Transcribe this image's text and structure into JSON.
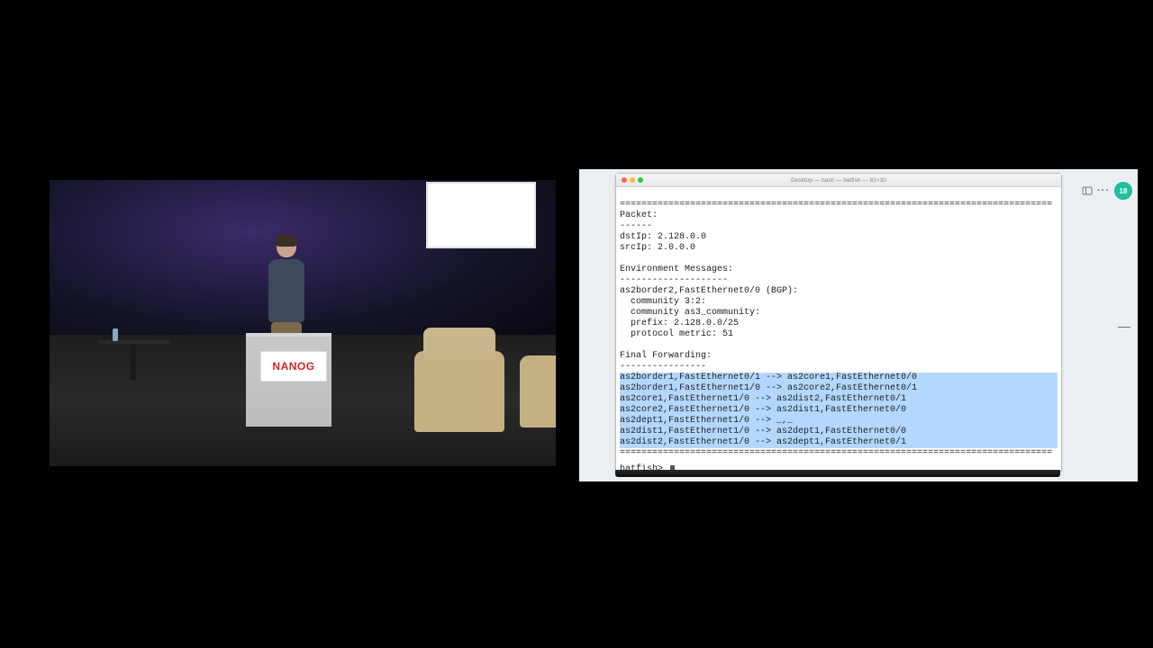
{
  "video": {
    "podium_sign": "NANOG"
  },
  "desktop": {
    "avatar_badge": "18",
    "right_icon_minus": "—"
  },
  "terminal": {
    "titlebar": "Desktop — bash — batfish — 81×30",
    "sep_line": "================================================================================",
    "packet_header": "Packet:",
    "packet_sep": "------",
    "dstip_line": "dstIp: 2.128.0.0",
    "srcip_line": "srcIp: 2.0.0.0",
    "env_header": "Environment Messages:",
    "env_sep": "--------------------",
    "env_line1": "as2border2,FastEthernet0/0 (BGP):",
    "env_line2": "  community 3:2:",
    "env_line3": "  community as3_community:",
    "env_line4": "  prefix: 2.128.0.0/25",
    "env_line5": "  protocol metric: 51",
    "fwd_header": "Final Forwarding:",
    "fwd_sep": "----------------",
    "fwd_rows": [
      "as2border1,FastEthernet0/1 --> as2core1,FastEthernet0/0",
      "as2border1,FastEthernet1/0 --> as2core2,FastEthernet0/1",
      "as2core1,FastEthernet1/0 --> as2dist2,FastEthernet0/1",
      "as2core2,FastEthernet1/0 --> as2dist1,FastEthernet0/0",
      "as2dept1,FastEthernet1/0 --> _,_",
      "as2dist1,FastEthernet1/0 --> as2dept1,FastEthernet0/0",
      "as2dist2,FastEthernet1/0 --> as2dept1,FastEthernet0/1"
    ],
    "prompt": "batfish> "
  }
}
